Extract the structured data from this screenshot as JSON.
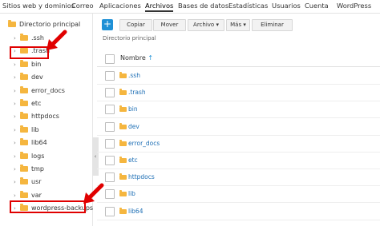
{
  "nav": {
    "tabs": [
      "Sitios web y dominios",
      "Correo",
      "Aplicaciones",
      "Archivos",
      "Bases de datos",
      "Estadísticas",
      "Usuarios",
      "Cuenta",
      "WordPress"
    ],
    "active": "Archivos"
  },
  "sidebar": {
    "root": "Directorio principal",
    "items": [
      ".ssh",
      ".trash",
      "bin",
      "dev",
      "error_docs",
      "etc",
      "httpdocs",
      "lib",
      "lib64",
      "logs",
      "tmp",
      "usr",
      "var",
      "wordpress-backups"
    ]
  },
  "toolbar": {
    "add": "+",
    "copy": "Copiar",
    "move": "Mover",
    "file": "Archivo",
    "more": "Más",
    "delete": "Eliminar"
  },
  "breadcrumb": "Directorio principal",
  "table": {
    "column": "Nombre",
    "sort_indicator": "↑",
    "rows": [
      ".ssh",
      ".trash",
      "bin",
      "dev",
      "error_docs",
      "etc",
      "httpdocs",
      "lib",
      "lib64"
    ]
  },
  "colors": {
    "accent": "#1e90d6",
    "folder": "#f5b63f",
    "highlight": "#e00000",
    "link": "#1e6fb5"
  }
}
